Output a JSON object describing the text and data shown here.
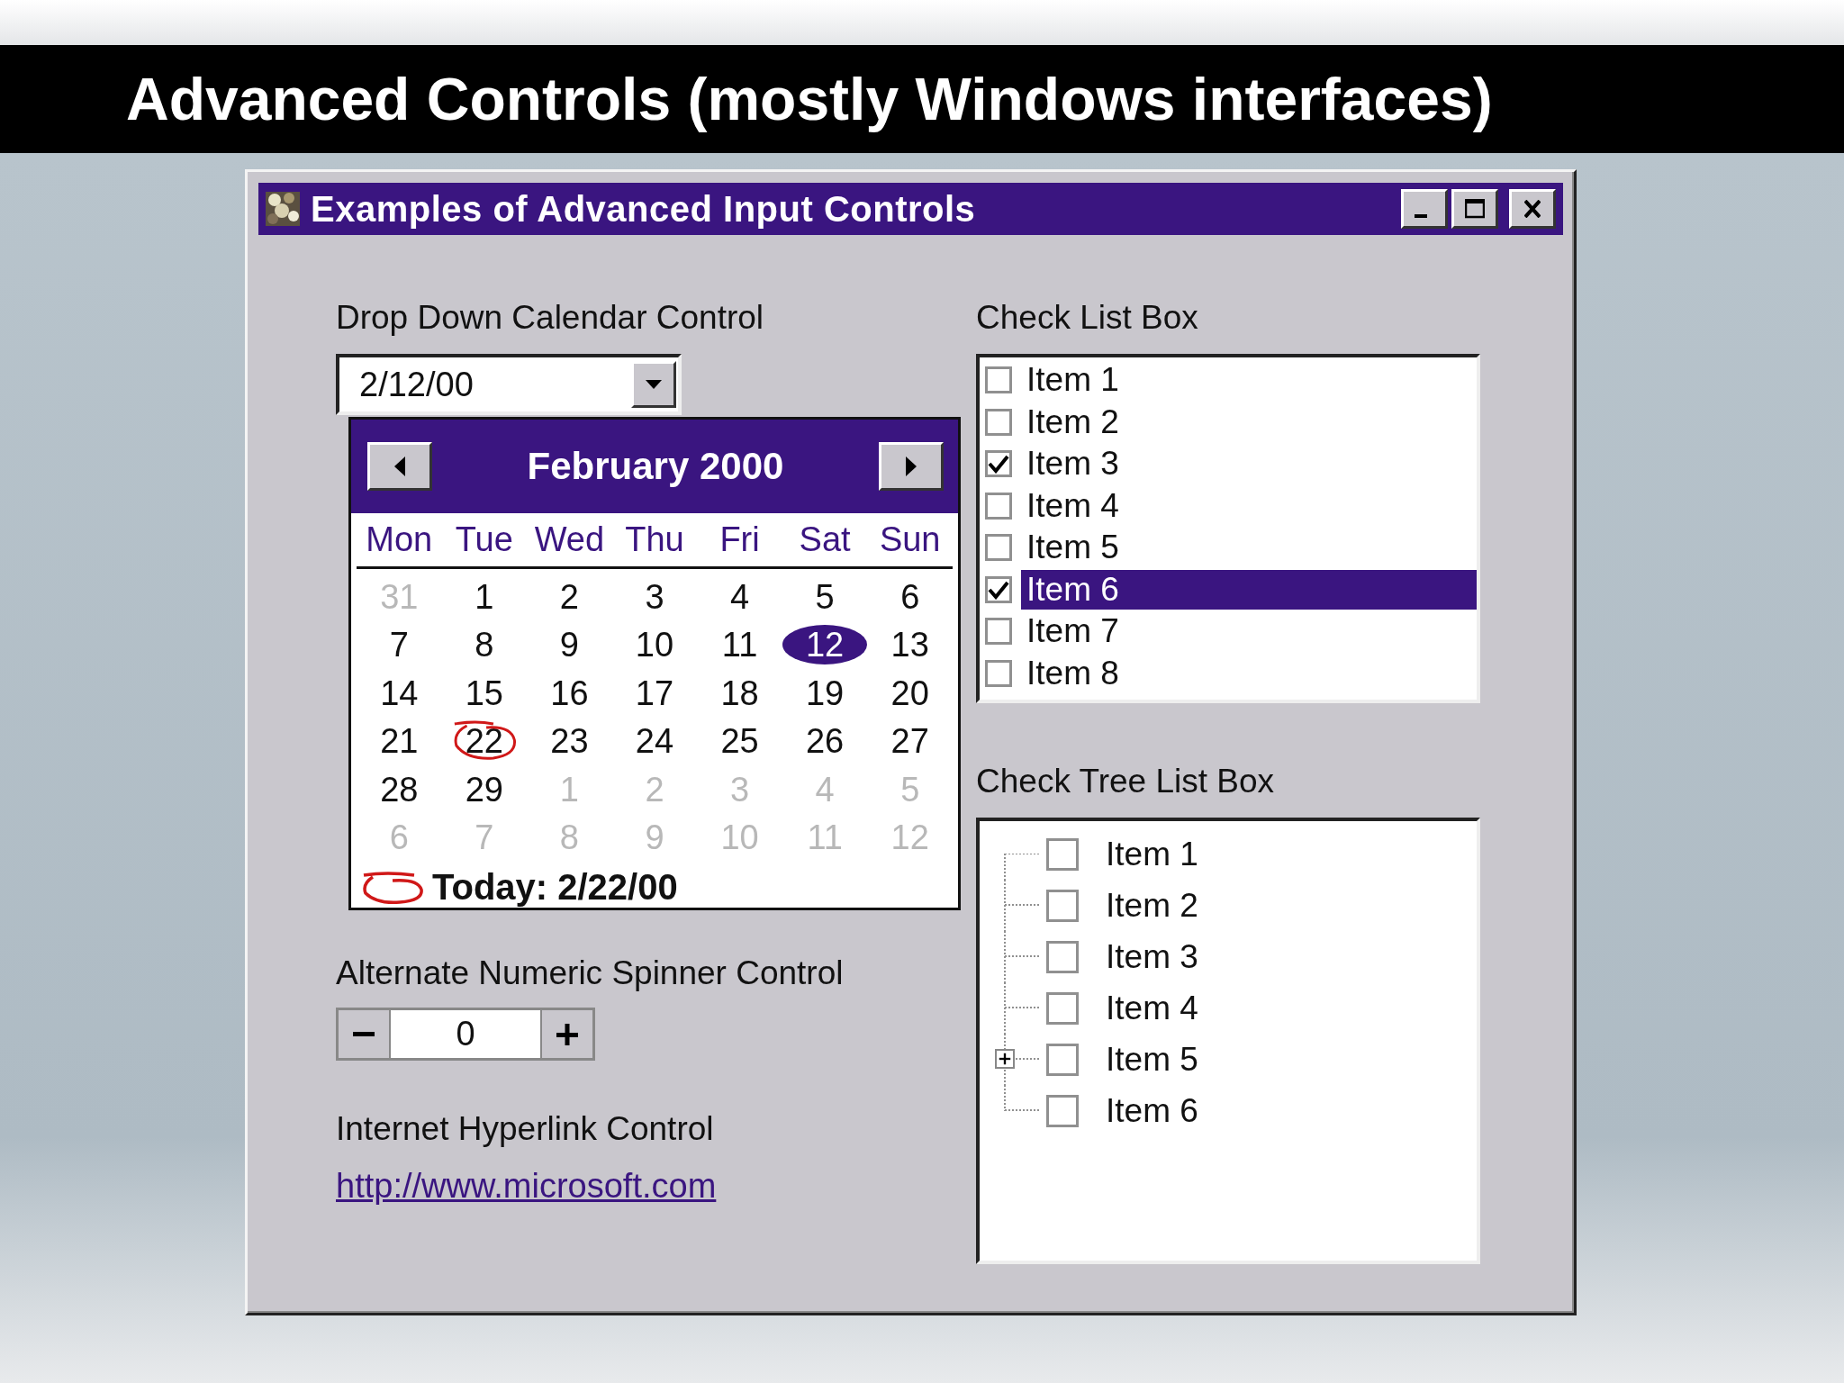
{
  "slide_title": "Advanced Controls (mostly Windows interfaces)",
  "window": {
    "title": "Examples of Advanced Input Controls"
  },
  "calendar_control": {
    "label": "Drop Down Calendar Control",
    "value": "2/12/00",
    "popup": {
      "month": "February 2000",
      "weekdays": [
        "Mon",
        "Tue",
        "Wed",
        "Thu",
        "Fri",
        "Sat",
        "Sun"
      ],
      "days": [
        {
          "text": "31",
          "in_month": false,
          "selected": false,
          "today": false
        },
        {
          "text": "1",
          "in_month": true,
          "selected": false,
          "today": false
        },
        {
          "text": "2",
          "in_month": true,
          "selected": false,
          "today": false
        },
        {
          "text": "3",
          "in_month": true,
          "selected": false,
          "today": false
        },
        {
          "text": "4",
          "in_month": true,
          "selected": false,
          "today": false
        },
        {
          "text": "5",
          "in_month": true,
          "selected": false,
          "today": false
        },
        {
          "text": "6",
          "in_month": true,
          "selected": false,
          "today": false
        },
        {
          "text": "7",
          "in_month": true,
          "selected": false,
          "today": false
        },
        {
          "text": "8",
          "in_month": true,
          "selected": false,
          "today": false
        },
        {
          "text": "9",
          "in_month": true,
          "selected": false,
          "today": false
        },
        {
          "text": "10",
          "in_month": true,
          "selected": false,
          "today": false
        },
        {
          "text": "11",
          "in_month": true,
          "selected": false,
          "today": false
        },
        {
          "text": "12",
          "in_month": true,
          "selected": true,
          "today": false
        },
        {
          "text": "13",
          "in_month": true,
          "selected": false,
          "today": false
        },
        {
          "text": "14",
          "in_month": true,
          "selected": false,
          "today": false
        },
        {
          "text": "15",
          "in_month": true,
          "selected": false,
          "today": false
        },
        {
          "text": "16",
          "in_month": true,
          "selected": false,
          "today": false
        },
        {
          "text": "17",
          "in_month": true,
          "selected": false,
          "today": false
        },
        {
          "text": "18",
          "in_month": true,
          "selected": false,
          "today": false
        },
        {
          "text": "19",
          "in_month": true,
          "selected": false,
          "today": false
        },
        {
          "text": "20",
          "in_month": true,
          "selected": false,
          "today": false
        },
        {
          "text": "21",
          "in_month": true,
          "selected": false,
          "today": false
        },
        {
          "text": "22",
          "in_month": true,
          "selected": false,
          "today": true
        },
        {
          "text": "23",
          "in_month": true,
          "selected": false,
          "today": false
        },
        {
          "text": "24",
          "in_month": true,
          "selected": false,
          "today": false
        },
        {
          "text": "25",
          "in_month": true,
          "selected": false,
          "today": false
        },
        {
          "text": "26",
          "in_month": true,
          "selected": false,
          "today": false
        },
        {
          "text": "27",
          "in_month": true,
          "selected": false,
          "today": false
        },
        {
          "text": "28",
          "in_month": true,
          "selected": false,
          "today": false
        },
        {
          "text": "29",
          "in_month": true,
          "selected": false,
          "today": false
        },
        {
          "text": "1",
          "in_month": false,
          "selected": false,
          "today": false
        },
        {
          "text": "2",
          "in_month": false,
          "selected": false,
          "today": false
        },
        {
          "text": "3",
          "in_month": false,
          "selected": false,
          "today": false
        },
        {
          "text": "4",
          "in_month": false,
          "selected": false,
          "today": false
        },
        {
          "text": "5",
          "in_month": false,
          "selected": false,
          "today": false
        },
        {
          "text": "6",
          "in_month": false,
          "selected": false,
          "today": false
        },
        {
          "text": "7",
          "in_month": false,
          "selected": false,
          "today": false
        },
        {
          "text": "8",
          "in_month": false,
          "selected": false,
          "today": false
        },
        {
          "text": "9",
          "in_month": false,
          "selected": false,
          "today": false
        },
        {
          "text": "10",
          "in_month": false,
          "selected": false,
          "today": false
        },
        {
          "text": "11",
          "in_month": false,
          "selected": false,
          "today": false
        },
        {
          "text": "12",
          "in_month": false,
          "selected": false,
          "today": false
        }
      ],
      "today_label": "Today: 2/22/00"
    }
  },
  "spinner": {
    "label": "Alternate Numeric Spinner Control",
    "value": "0"
  },
  "hyperlink": {
    "label": "Internet Hyperlink Control",
    "url": "http://www.microsoft.com"
  },
  "check_list": {
    "label": "Check List Box",
    "items": [
      {
        "label": "Item 1",
        "checked": false,
        "selected": false
      },
      {
        "label": "Item 2",
        "checked": false,
        "selected": false
      },
      {
        "label": "Item 3",
        "checked": true,
        "selected": false
      },
      {
        "label": "Item 4",
        "checked": false,
        "selected": false
      },
      {
        "label": "Item 5",
        "checked": false,
        "selected": false
      },
      {
        "label": "Item 6",
        "checked": true,
        "selected": true
      },
      {
        "label": "Item 7",
        "checked": false,
        "selected": false
      },
      {
        "label": "Item 8",
        "checked": false,
        "selected": false
      }
    ]
  },
  "check_tree": {
    "label": "Check Tree List Box",
    "items": [
      {
        "label": "Item 1",
        "checked": false,
        "kind": "leaf"
      },
      {
        "label": "Item 2",
        "checked": false,
        "kind": "leaf"
      },
      {
        "label": "Item 3",
        "checked": false,
        "kind": "leaf"
      },
      {
        "label": "Item 4",
        "checked": false,
        "kind": "leaf"
      },
      {
        "label": "Item 5",
        "checked": false,
        "kind": "node"
      },
      {
        "label": "Item 6",
        "checked": false,
        "kind": "leaf"
      }
    ]
  }
}
